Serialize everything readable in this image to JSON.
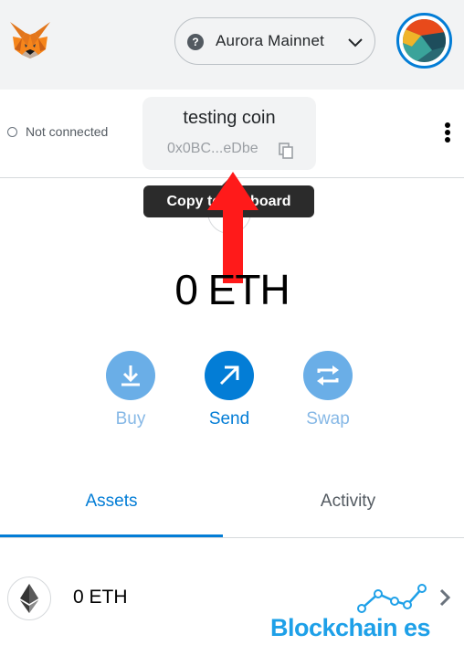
{
  "header": {
    "network": "Aurora Mainnet",
    "network_icon_glyph": "?",
    "icons": [
      "metamask-fox-icon",
      "network-help-icon",
      "chevron-down-icon",
      "account-avatar"
    ]
  },
  "account": {
    "connection_status": "Not connected",
    "name": "testing coin",
    "address_short": "0x0BC...eDbe",
    "tooltip": "Copy to clipboard"
  },
  "balance": {
    "amount": "0 ETH"
  },
  "actions": [
    {
      "label": "Buy",
      "icon": "download-icon"
    },
    {
      "label": "Send",
      "icon": "arrow-up-right-icon"
    },
    {
      "label": "Swap",
      "icon": "swap-arrows-icon"
    }
  ],
  "tabs": [
    {
      "label": "Assets",
      "active": true
    },
    {
      "label": "Activity",
      "active": false
    }
  ],
  "assets": [
    {
      "label": "0 ETH",
      "icon": "ethereum-icon"
    }
  ],
  "watermark": {
    "text": "Blockchain es"
  },
  "colors": {
    "primary": "#037dd6",
    "primary_muted": "#6aaee7",
    "header_bg": "#f2f3f4",
    "annotation_arrow": "#ff1a1a"
  }
}
